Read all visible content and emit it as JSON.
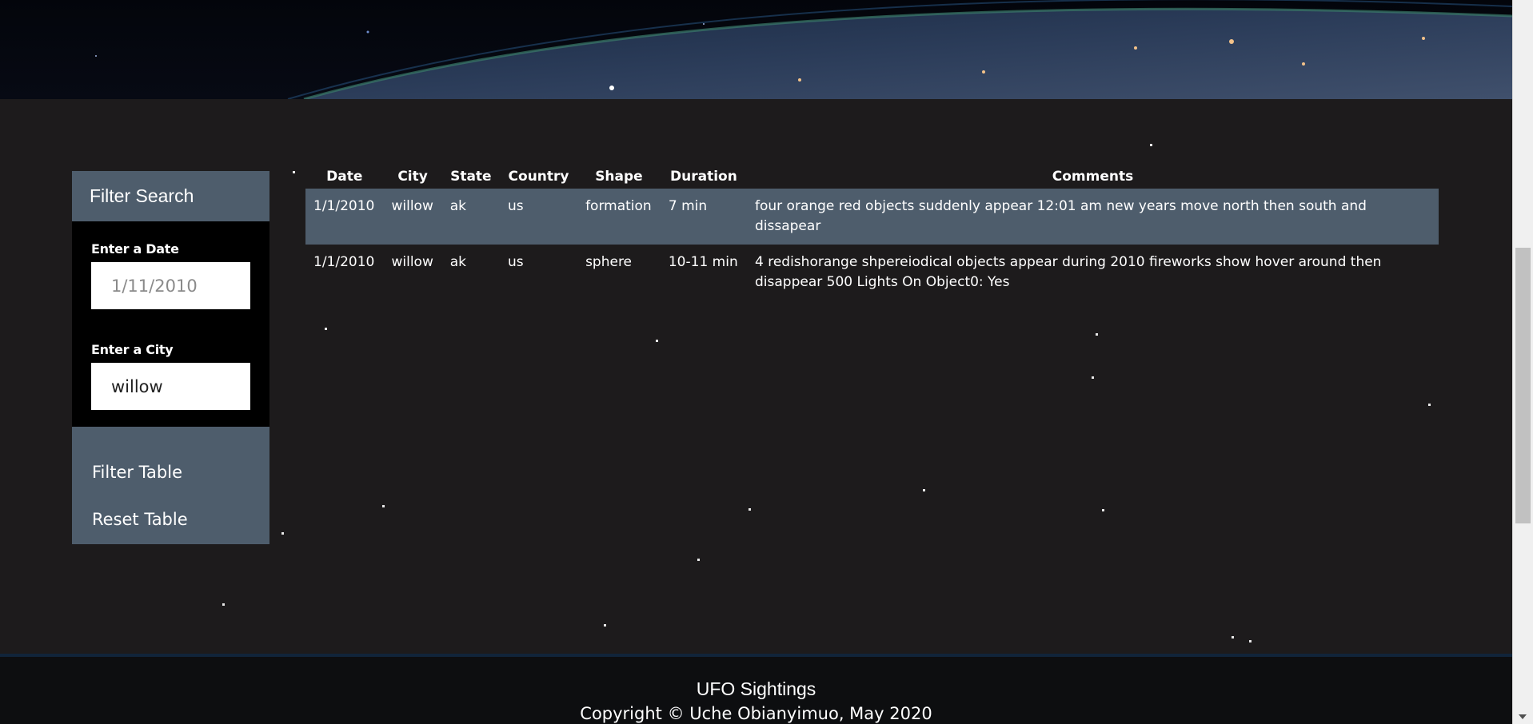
{
  "filter": {
    "title": "Filter Search",
    "date_label": "Enter a Date",
    "date_placeholder": "1/11/2010",
    "city_label": "Enter a City",
    "city_value": "willow",
    "filter_button": "Filter Table",
    "reset_button": "Reset Table"
  },
  "table": {
    "headers": [
      "Date",
      "City",
      "State",
      "Country",
      "Shape",
      "Duration",
      "Comments"
    ],
    "rows": [
      {
        "date": "1/1/2010",
        "city": "willow",
        "state": "ak",
        "country": "us",
        "shape": "formation",
        "duration": "7 min",
        "comments": "four orange red objects suddenly appear 12:01 am new years move north then south and dissapear"
      },
      {
        "date": "1/1/2010",
        "city": "willow",
        "state": "ak",
        "country": "us",
        "shape": "sphere",
        "duration": "10-11 min",
        "comments": "4 redishorange shpereiodical objects appear during 2010 fireworks show hover around then disappear 500 Lights On Object0: Yes"
      }
    ]
  },
  "footer": {
    "title": "UFO Sightings",
    "copyright": "Copyright © Uche Obianyimuo, May 2020"
  },
  "colors": {
    "page_background": "#1d1b1c",
    "accent": "#4e5d6c",
    "panel_black": "#000000",
    "footer_background": "#0d0e10"
  }
}
